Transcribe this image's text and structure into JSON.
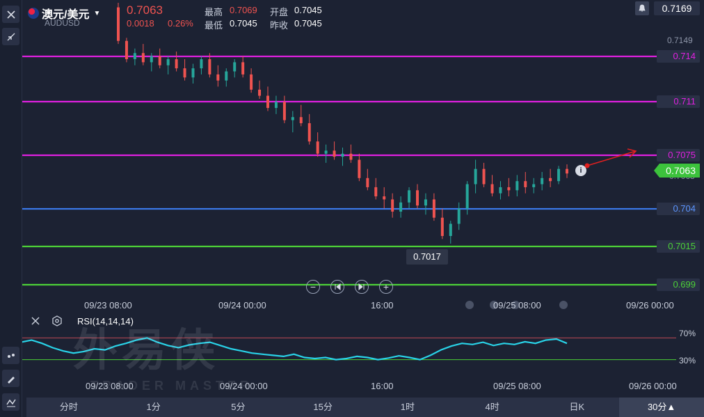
{
  "symbol": {
    "name": "澳元/美元",
    "code": "AUDUSD",
    "price": "0.7063",
    "change": "0.0018",
    "change_pct": "0.26%"
  },
  "stats": {
    "high_label": "最高",
    "high": "0.7069",
    "open_label": "开盘",
    "open": "0.7045",
    "low_label": "最低",
    "low": "0.7045",
    "prev_close_label": "昨收",
    "prev_close": "0.7045"
  },
  "alert_price": "0.7169",
  "price_axis": {
    "top_label": "0.7149",
    "current_price": "0.7063",
    "partial_label": "0.7063"
  },
  "levels": [
    {
      "value": "0.714",
      "color": "#e020e0",
      "text_color": "#e020e0"
    },
    {
      "value": "0.711",
      "color": "#e020e0",
      "text_color": "#e020e0"
    },
    {
      "value": "0.7075",
      "color": "#e020e0",
      "text_color": "#e020e0"
    },
    {
      "value": "0.704",
      "color": "#3a78e8",
      "text_color": "#5b95ff"
    },
    {
      "value": "0.7015",
      "color": "#4cd137",
      "text_color": "#4cd137"
    },
    {
      "value": "0.699",
      "color": "#4cd137",
      "text_color": "#4cd137"
    }
  ],
  "low_callout": "0.7017",
  "time_axis": [
    "09/23 08:00",
    "09/24 00:00",
    "16:00",
    "09/25 08:00",
    "09/26 00:00"
  ],
  "indicator": {
    "name": "RSI(14,14,14)",
    "level_high": "70%",
    "level_low": "30%"
  },
  "watermark": {
    "cn": "外易侠",
    "en": "TRADER MASTER"
  },
  "timeframes": [
    "分时",
    "1分",
    "5分",
    "15分",
    "1时",
    "4时",
    "日K",
    "30分▲"
  ],
  "active_timeframe": "30分▲",
  "colors": {
    "up": "#26a69a",
    "down": "#ef5350",
    "rsi": "#29d3e8",
    "background": "#1c2233"
  },
  "chart_data": {
    "type": "candlestick",
    "symbol": "AUDUSD",
    "interval": "30分",
    "ylim": [
      0.6985,
      0.7175
    ],
    "levels": [
      0.714,
      0.711,
      0.7075,
      0.704,
      0.7015,
      0.699
    ],
    "candles": [
      [
        0.7172,
        0.7175,
        0.7148,
        0.715
      ],
      [
        0.715,
        0.7152,
        0.7136,
        0.7138
      ],
      [
        0.7138,
        0.7145,
        0.7134,
        0.7142
      ],
      [
        0.7142,
        0.7148,
        0.7134,
        0.7136
      ],
      [
        0.7136,
        0.7142,
        0.713,
        0.714
      ],
      [
        0.714,
        0.7145,
        0.7132,
        0.7134
      ],
      [
        0.7134,
        0.714,
        0.7128,
        0.7138
      ],
      [
        0.7138,
        0.7143,
        0.713,
        0.7132
      ],
      [
        0.7132,
        0.7138,
        0.7124,
        0.7126
      ],
      [
        0.7126,
        0.7135,
        0.7122,
        0.7132
      ],
      [
        0.7132,
        0.714,
        0.7128,
        0.7138
      ],
      [
        0.7138,
        0.7142,
        0.7126,
        0.7128
      ],
      [
        0.7128,
        0.7134,
        0.712,
        0.7124
      ],
      [
        0.7124,
        0.7132,
        0.712,
        0.713
      ],
      [
        0.713,
        0.7138,
        0.7126,
        0.7136
      ],
      [
        0.7136,
        0.714,
        0.7126,
        0.7128
      ],
      [
        0.7128,
        0.7132,
        0.7116,
        0.7118
      ],
      [
        0.7118,
        0.7124,
        0.7112,
        0.7114
      ],
      [
        0.7114,
        0.712,
        0.7104,
        0.7106
      ],
      [
        0.7106,
        0.7114,
        0.7102,
        0.711
      ],
      [
        0.711,
        0.7114,
        0.7096,
        0.7098
      ],
      [
        0.7098,
        0.7104,
        0.709,
        0.71
      ],
      [
        0.71,
        0.7108,
        0.7094,
        0.7096
      ],
      [
        0.7096,
        0.7102,
        0.7082,
        0.7084
      ],
      [
        0.7084,
        0.709,
        0.7074,
        0.7076
      ],
      [
        0.7076,
        0.7082,
        0.707,
        0.7078
      ],
      [
        0.7078,
        0.7084,
        0.7072,
        0.7074
      ],
      [
        0.7074,
        0.708,
        0.7068,
        0.7076
      ],
      [
        0.7076,
        0.7082,
        0.707,
        0.7072
      ],
      [
        0.7072,
        0.7076,
        0.7058,
        0.706
      ],
      [
        0.706,
        0.7066,
        0.7052,
        0.7054
      ],
      [
        0.7054,
        0.706,
        0.7046,
        0.7048
      ],
      [
        0.7048,
        0.7054,
        0.704,
        0.7046
      ],
      [
        0.7046,
        0.705,
        0.7034,
        0.7038
      ],
      [
        0.7038,
        0.7048,
        0.7034,
        0.7044
      ],
      [
        0.7044,
        0.7054,
        0.704,
        0.7052
      ],
      [
        0.7052,
        0.7056,
        0.704,
        0.7042
      ],
      [
        0.7042,
        0.705,
        0.7036,
        0.7046
      ],
      [
        0.7046,
        0.705,
        0.7032,
        0.7034
      ],
      [
        0.7034,
        0.704,
        0.702,
        0.7022
      ],
      [
        0.7022,
        0.7032,
        0.7017,
        0.703
      ],
      [
        0.703,
        0.7044,
        0.7026,
        0.704
      ],
      [
        0.704,
        0.7058,
        0.7036,
        0.7056
      ],
      [
        0.7056,
        0.7072,
        0.705,
        0.7066
      ],
      [
        0.7066,
        0.707,
        0.7054,
        0.7056
      ],
      [
        0.7056,
        0.7062,
        0.7048,
        0.705
      ],
      [
        0.705,
        0.7058,
        0.7046,
        0.7054
      ],
      [
        0.7054,
        0.706,
        0.7048,
        0.7052
      ],
      [
        0.7052,
        0.7062,
        0.7048,
        0.7058
      ],
      [
        0.7058,
        0.7064,
        0.705,
        0.7054
      ],
      [
        0.7054,
        0.706,
        0.705,
        0.7056
      ],
      [
        0.7056,
        0.7064,
        0.7052,
        0.706
      ],
      [
        0.706,
        0.7066,
        0.7054,
        0.7058
      ],
      [
        0.7058,
        0.7068,
        0.7056,
        0.7066
      ],
      [
        0.7066,
        0.7069,
        0.706,
        0.7063
      ]
    ],
    "rsi": {
      "name": "RSI(14,14,14)",
      "levels": [
        70,
        30
      ],
      "values": [
        58,
        55,
        62,
        66,
        60,
        52,
        46,
        42,
        45,
        50,
        48,
        55,
        60,
        66,
        70,
        62,
        56,
        52,
        57,
        60,
        62,
        56,
        50,
        46,
        42,
        40,
        38,
        36,
        40,
        34,
        32,
        34,
        30,
        32,
        36,
        34,
        30,
        33,
        37,
        34,
        30,
        38,
        48,
        55,
        60,
        58,
        62,
        56,
        60,
        58,
        63,
        60,
        66,
        68,
        60
      ]
    },
    "time_labels": [
      "09/23 08:00",
      "09/24 00:00",
      "16:00",
      "09/25 08:00",
      "09/26 00:00"
    ]
  }
}
